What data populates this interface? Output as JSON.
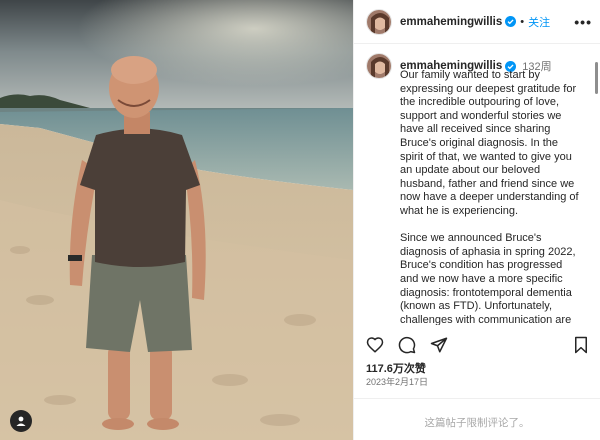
{
  "post": {
    "username": "emmahemingwillis",
    "follow_label": "关注",
    "dot": "•",
    "more_label": "•••",
    "age": "132周",
    "caption_paragraphs": [
      "Our family wanted to start by expressing our deepest gratitude for the incredible outpouring of love, support and wonderful stories we have all received since sharing Bruce's original diagnosis. In the spirit of that, we wanted to give you an update about our beloved husband, father and friend since we now have a deeper understanding of what he is experiencing.",
      "Since we announced Bruce's diagnosis of aphasia in spring 2022, Bruce's condition has progressed and we now have a more specific diagnosis: frontotemporal dementia (known as FTD). Unfortunately, challenges with communication are just one symptom of the disease"
    ],
    "likes": "117.6万次赞",
    "date": "2023年2月17日",
    "comments_disabled": "这篇帖子限制评论了。"
  },
  "icons": {
    "verified": "verified-badge-icon",
    "like": "heart-icon",
    "comment": "comment-icon",
    "share": "share-icon",
    "save": "bookmark-icon",
    "tagged_user": "user-tag-icon"
  },
  "colors": {
    "accent": "#0095f6",
    "text": "#262626",
    "muted": "#737373",
    "border": "#efefef"
  }
}
